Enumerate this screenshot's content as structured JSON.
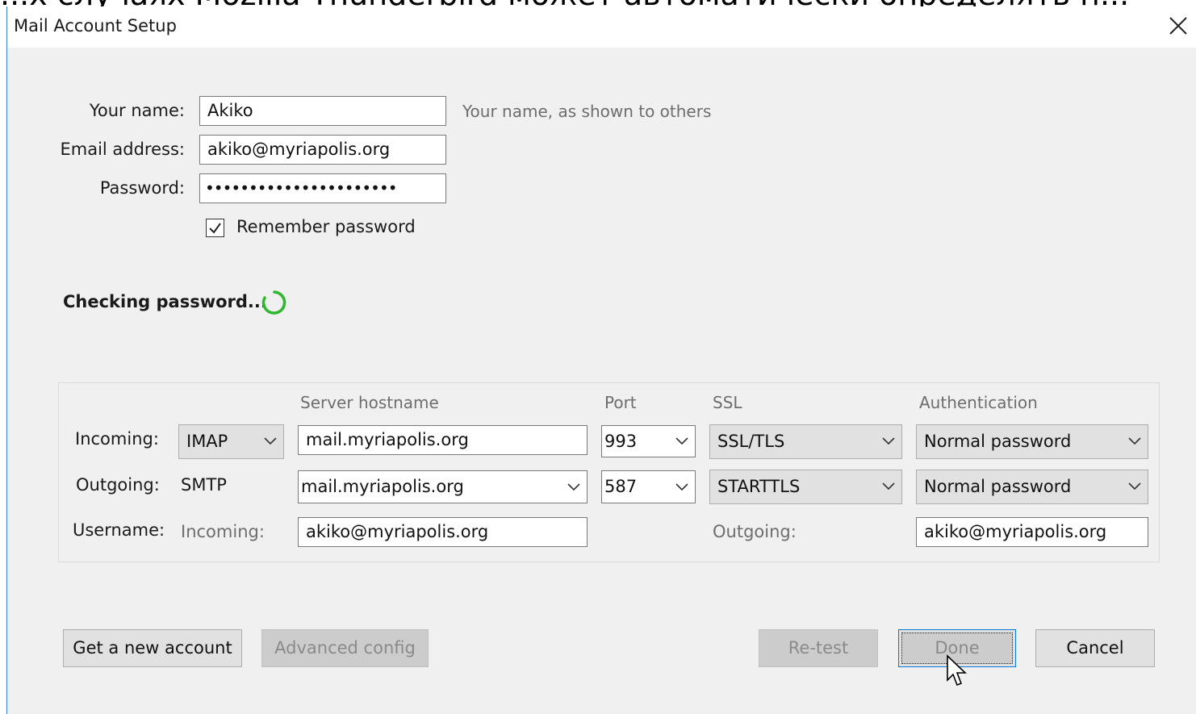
{
  "background_text": "...х случаях Mozilla Thunderbird может автоматически определять п...",
  "window": {
    "title": "Mail Account Setup"
  },
  "form": {
    "name_label": "Your name:",
    "name_value": "Akiko",
    "name_hint": "Your name, as shown to others",
    "email_label": "Email address:",
    "email_value": "akiko@myriapolis.org",
    "password_label": "Password:",
    "password_value": "••••••••••••••••••••••",
    "remember_label": "Remember password",
    "remember_checked": true
  },
  "status": {
    "text": "Checking password...",
    "spinner_color": "#2eb82e"
  },
  "servers": {
    "col_hostname": "Server hostname",
    "col_port": "Port",
    "col_ssl": "SSL",
    "col_auth": "Authentication",
    "incoming": {
      "label": "Incoming:",
      "protocol": "IMAP",
      "hostname": "mail.myriapolis.org",
      "port": "993",
      "ssl": "SSL/TLS",
      "auth": "Normal password"
    },
    "outgoing": {
      "label": "Outgoing:",
      "protocol": "SMTP",
      "hostname": "mail.myriapolis.org",
      "port": "587",
      "ssl": "STARTTLS",
      "auth": "Normal password"
    },
    "username": {
      "label": "Username:",
      "incoming_label": "Incoming:",
      "incoming_value": "akiko@myriapolis.org",
      "outgoing_label": "Outgoing:",
      "outgoing_value": "akiko@myriapolis.org"
    }
  },
  "buttons": {
    "new_account": "Get a new account",
    "advanced": "Advanced config",
    "retest": "Re-test",
    "done": "Done",
    "cancel": "Cancel"
  }
}
